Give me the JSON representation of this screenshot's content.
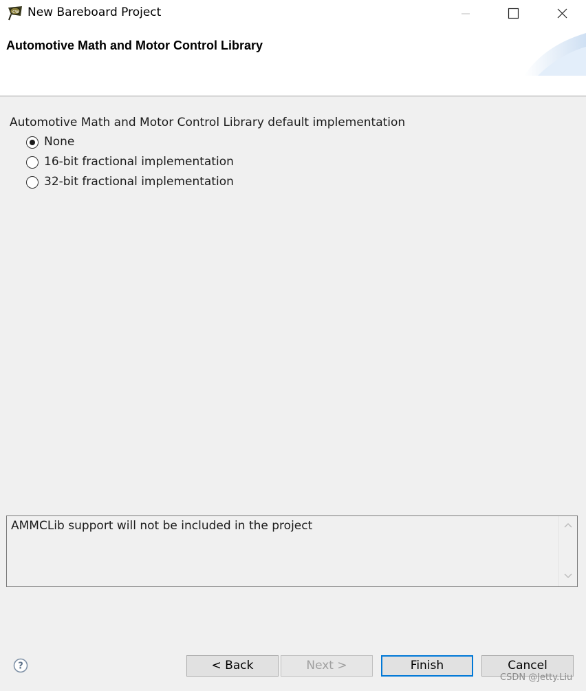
{
  "window": {
    "title": "New Bareboard Project",
    "icon": "eclipse-codewarrior-icon"
  },
  "banner": {
    "title": "Automotive Math and Motor Control Library"
  },
  "options": {
    "group_label": "Automotive Math and Motor Control Library default implementation",
    "items": [
      {
        "label": "None",
        "selected": true
      },
      {
        "label": "16-bit fractional implementation",
        "selected": false
      },
      {
        "label": "32-bit fractional implementation",
        "selected": false
      }
    ]
  },
  "description": {
    "text": "AMMCLib support will not be included in the project"
  },
  "footer": {
    "back_label": "< Back",
    "next_label": "Next >",
    "finish_label": "Finish",
    "cancel_label": "Cancel"
  },
  "watermark": "CSDN @Jetty.Liu",
  "colors": {
    "accent": "#0078d7",
    "background": "#f0f0f0",
    "disabled_text": "#a0a0a0"
  }
}
